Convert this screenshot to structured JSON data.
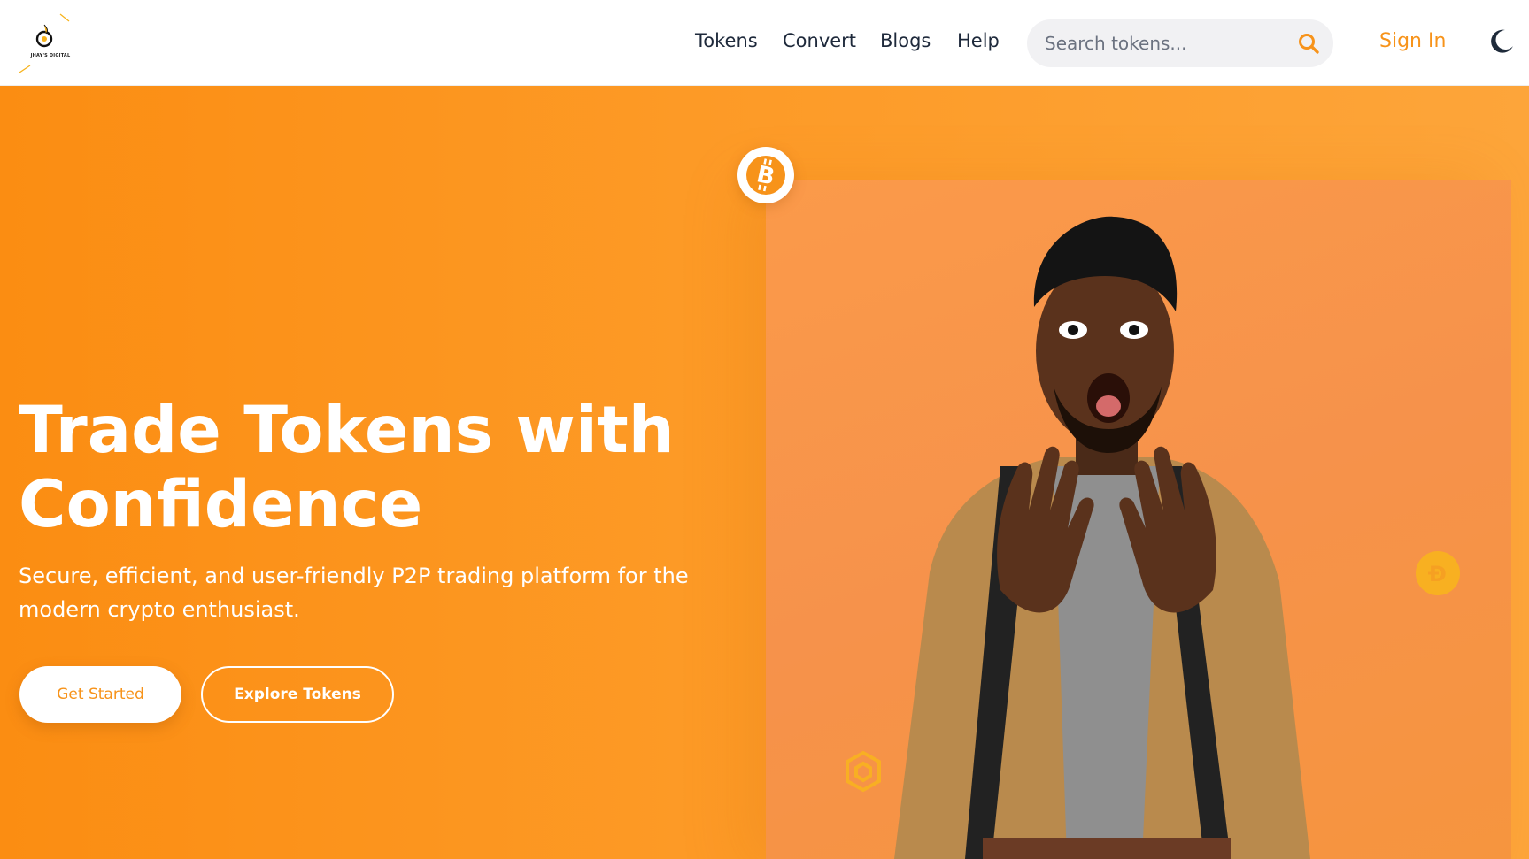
{
  "header": {
    "logo_text": "JHAY'S DIGITAL",
    "nav": [
      {
        "label": "Tokens"
      },
      {
        "label": "Convert"
      },
      {
        "label": "Blogs"
      },
      {
        "label": "Help"
      }
    ],
    "search": {
      "placeholder": "Search tokens...",
      "value": "",
      "icon": "search-icon"
    },
    "sign_in_label": "Sign In",
    "theme_toggle_icon": "moon-icon"
  },
  "hero": {
    "title": "Trade Tokens with Confidence",
    "subtitle": "Secure, efficient, and user-friendly P2P trading platform for the modern crypto enthusiast.",
    "primary_button": "Get Started",
    "secondary_button": "Explore Tokens",
    "floating_icons": [
      "bitcoin-icon",
      "dogecoin-icon",
      "bnb-icon"
    ]
  },
  "colors": {
    "accent": "#f7931a",
    "hero_gradient_start": "#fb8d12",
    "hero_gradient_end": "#fda53a",
    "nav_text": "#1e293b",
    "search_bg": "#f1f1f3"
  }
}
